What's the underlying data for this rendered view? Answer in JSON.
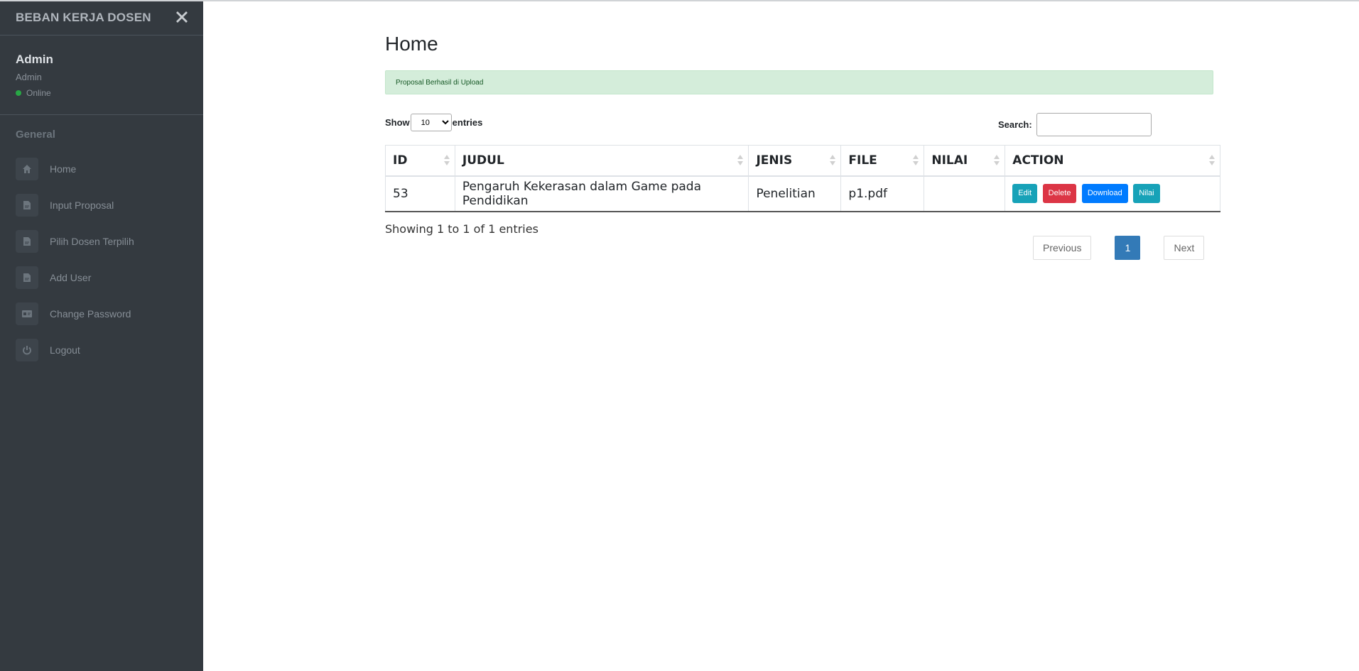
{
  "sidebar": {
    "brand": "BEBAN KERJA DOSEN",
    "user": {
      "name": "Admin",
      "role": "Admin",
      "status": "Online"
    },
    "section_header": "General",
    "items": [
      {
        "label": "Home",
        "icon": "home-icon"
      },
      {
        "label": "Input Proposal",
        "icon": "file-icon"
      },
      {
        "label": "Pilih Dosen Terpilih",
        "icon": "file-icon"
      },
      {
        "label": "Add User",
        "icon": "file-icon"
      },
      {
        "label": "Change Password",
        "icon": "id-card-icon"
      },
      {
        "label": "Logout",
        "icon": "power-icon"
      }
    ]
  },
  "main": {
    "title": "Home",
    "alert": "Proposal Berhasil di Upload",
    "length": {
      "show": "Show",
      "value": "10",
      "entries": "entries"
    },
    "search": {
      "label": "Search:",
      "value": ""
    },
    "table": {
      "columns": [
        "ID",
        "JUDUL",
        "JENIS",
        "FILE",
        "NILAI",
        "ACTION"
      ],
      "rows": [
        {
          "id": "53",
          "judul": "Pengaruh Kekerasan dalam Game pada Pendidikan",
          "jenis": "Penelitian",
          "file": "p1.pdf",
          "nilai": ""
        }
      ],
      "actions": {
        "edit": "Edit",
        "delete": "Delete",
        "download": "Download",
        "nilai": "Nilai"
      }
    },
    "info": "Showing 1 to 1 of 1 entries",
    "pagination": {
      "previous": "Previous",
      "current": "1",
      "next": "Next"
    }
  },
  "colors": {
    "sidebar_bg": "#343a40",
    "alert_bg": "#d4edda",
    "info": "#17a2b8",
    "danger": "#dc3545",
    "primary": "#007bff",
    "page_active": "#337ab7"
  }
}
